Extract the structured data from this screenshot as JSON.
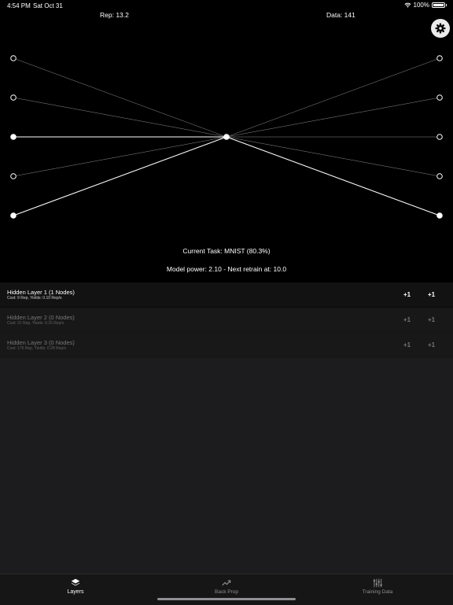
{
  "status_bar": {
    "time": "4:54 PM",
    "date": "Sat Oct 31",
    "battery": "100%",
    "battery_level": 1.0
  },
  "stats": {
    "rep": "Rep: 13.2",
    "data": "Data: 141"
  },
  "settings": {
    "icon": "gear-icon"
  },
  "network": {
    "edge_color": "#ffffff",
    "input_node_filled": [
      false,
      false,
      true,
      false,
      true
    ],
    "output_node_filled": [
      false,
      false,
      false,
      false,
      true
    ],
    "strong_input_edges": [
      2,
      4
    ],
    "strong_output_edges": [
      4
    ]
  },
  "task": {
    "current": "Current Task: MNIST (80.3%)",
    "power": "Model power: 2.10 - Next retrain at: 10.0"
  },
  "layers": [
    {
      "title": "Hidden Layer 1 (1 Nodes)",
      "subtitle": "Cost: 9 Rep, Yields: 0.10 Rep/s",
      "plus_a": "+1",
      "plus_b": "+1",
      "enabled": true
    },
    {
      "title": "Hidden Layer 2 (0 Nodes)",
      "subtitle": "Cost: 31 Rep, Yields: 0.16 Rep/s",
      "plus_a": "+1",
      "plus_b": "+1",
      "enabled": false
    },
    {
      "title": "Hidden Layer 3 (0 Nodes)",
      "subtitle": "Cost: 175 Rep, Yields: 0.28 Rep/s",
      "plus_a": "+1",
      "plus_b": "+1",
      "enabled": false
    }
  ],
  "tabs": [
    {
      "label": "Layers",
      "icon": "layers-icon",
      "active": true
    },
    {
      "label": "Back Prop",
      "icon": "trend-icon",
      "active": false
    },
    {
      "label": "Training Data",
      "icon": "sliders-icon",
      "active": false
    }
  ]
}
